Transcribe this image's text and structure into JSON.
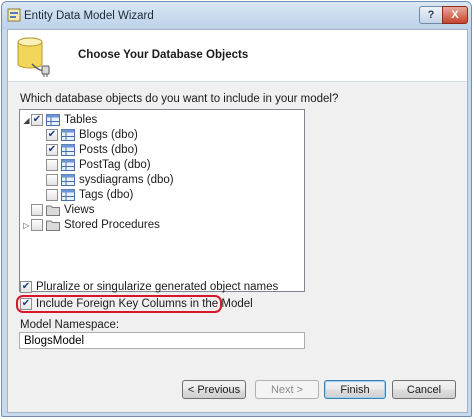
{
  "window": {
    "title": "Entity Data Model Wizard",
    "help_glyph": "?",
    "close_glyph": "X"
  },
  "header": {
    "title": "Choose Your Database Objects"
  },
  "question": "Which database objects do you want to include in your model?",
  "tree": {
    "tables": {
      "label": "Tables",
      "expanded": true,
      "checked": true,
      "items": [
        {
          "label": "Blogs (dbo)",
          "checked": true
        },
        {
          "label": "Posts (dbo)",
          "checked": true
        },
        {
          "label": "PostTag (dbo)",
          "checked": false
        },
        {
          "label": "sysdiagrams (dbo)",
          "checked": false
        },
        {
          "label": "Tags (dbo)",
          "checked": false
        }
      ]
    },
    "views": {
      "label": "Views",
      "checked": false
    },
    "stored_procedures": {
      "label": "Stored Procedures",
      "checked": false
    }
  },
  "options": {
    "pluralize": {
      "label": "Pluralize or singularize generated object names",
      "checked": true
    },
    "foreign_keys": {
      "label": "Include Foreign Key Columns in the Model",
      "checked": true
    }
  },
  "namespace": {
    "label": "Model Namespace:",
    "value": "BlogsModel"
  },
  "buttons": {
    "previous": "< Previous",
    "next": "Next >",
    "finish": "Finish",
    "cancel": "Cancel"
  },
  "colors": {
    "highlight": "#d8152a",
    "title_bar": "#c8d9ec"
  },
  "icons": {
    "app": "wizard-app-icon",
    "header": "database-icon",
    "table": "table-icon",
    "folder": "folder-icon"
  }
}
